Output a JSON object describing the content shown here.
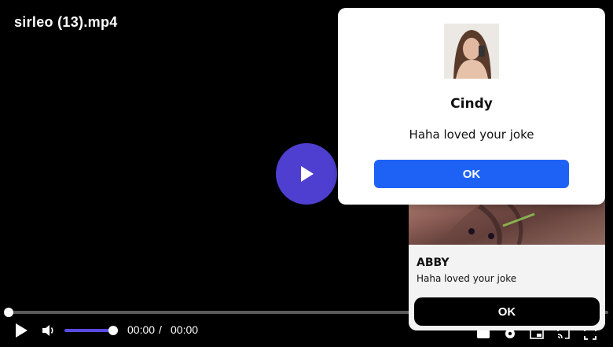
{
  "player": {
    "title": "sirleo (13).mp4",
    "current_time": "00:00",
    "separator": "/",
    "duration": "00:00",
    "progress": 0,
    "volume": 1.0,
    "accent_color": "#4f3fd0",
    "icons": [
      "play-icon",
      "volume-icon",
      "captions-icon",
      "settings-icon",
      "pip-icon",
      "cast-icon",
      "fullscreen-icon"
    ]
  },
  "notifications": {
    "abby": {
      "name": "ABBY",
      "message": "Haha loved your joke",
      "button_label": "OK",
      "button_color": "#000000"
    },
    "cindy": {
      "name": "Cindy",
      "message": "Haha loved your joke",
      "button_label": "OK",
      "button_color": "#1e62f5"
    }
  }
}
